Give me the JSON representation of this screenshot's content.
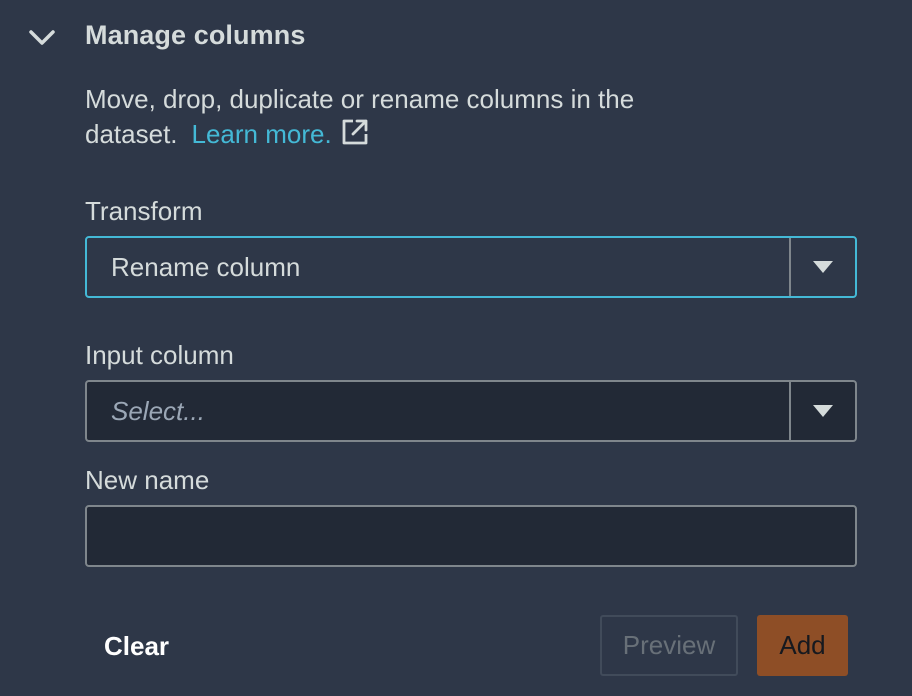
{
  "panel": {
    "title": "Manage columns",
    "description": "Move, drop, duplicate or rename columns in the dataset.",
    "learn_more": "Learn more.",
    "toggle_icon": "chevron-down-icon"
  },
  "transform": {
    "label": "Transform",
    "value": "Rename column"
  },
  "input_column": {
    "label": "Input column",
    "placeholder": "Select..."
  },
  "new_name": {
    "label": "New name",
    "value": ""
  },
  "actions": {
    "clear": "Clear",
    "preview": "Preview",
    "add": "Add"
  },
  "colors": {
    "background": "#2e3748",
    "link": "#44b9d6",
    "focus_border": "#44b9d6",
    "add_button": "#8e4e26",
    "text": "#d5dbdb"
  }
}
